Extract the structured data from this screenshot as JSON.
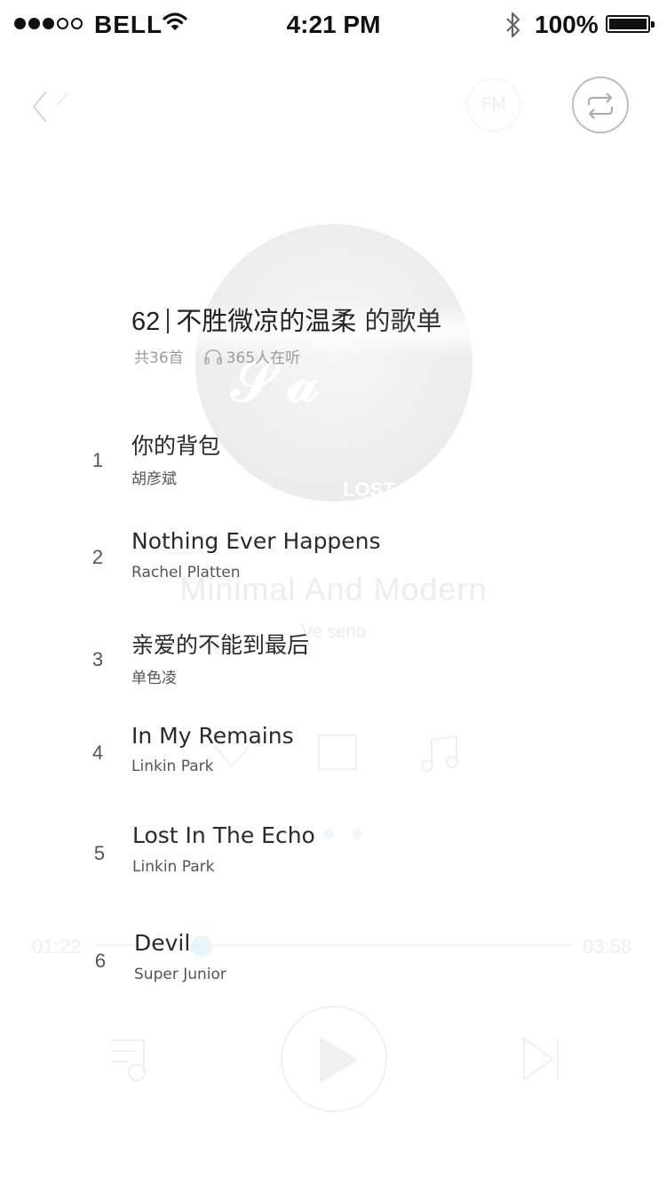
{
  "status_bar": {
    "carrier": "BELL",
    "time": "4:21 PM",
    "battery": "100%"
  },
  "background_player": {
    "album_label": "LOST",
    "song_title": "Minimal And Modern",
    "artist": "Ve seno",
    "elapsed": "01:22",
    "duration": "03:58"
  },
  "playlist": {
    "number": "62",
    "name": "不胜微凉的温柔",
    "suffix": "的歌单",
    "count": "共36首",
    "listeners": "365人在听",
    "songs": [
      {
        "index": "1",
        "title": "你的背包",
        "artist": "胡彦斌"
      },
      {
        "index": "2",
        "title": "Nothing Ever Happens",
        "artist": "Rachel Platten"
      },
      {
        "index": "3",
        "title": "亲爱的不能到最后",
        "artist": "单色凌"
      },
      {
        "index": "4",
        "title": "In My Remains",
        "artist": "Linkin Park"
      },
      {
        "index": "5",
        "title": "Lost In The Echo",
        "artist": "Linkin Park"
      },
      {
        "index": "6",
        "title": "Devil",
        "artist": "Super Junior"
      }
    ]
  },
  "icons": {
    "back": "chevron-left-icon",
    "fm": "FM",
    "loop": "repeat-icon",
    "listeners": "headphones-icon"
  }
}
